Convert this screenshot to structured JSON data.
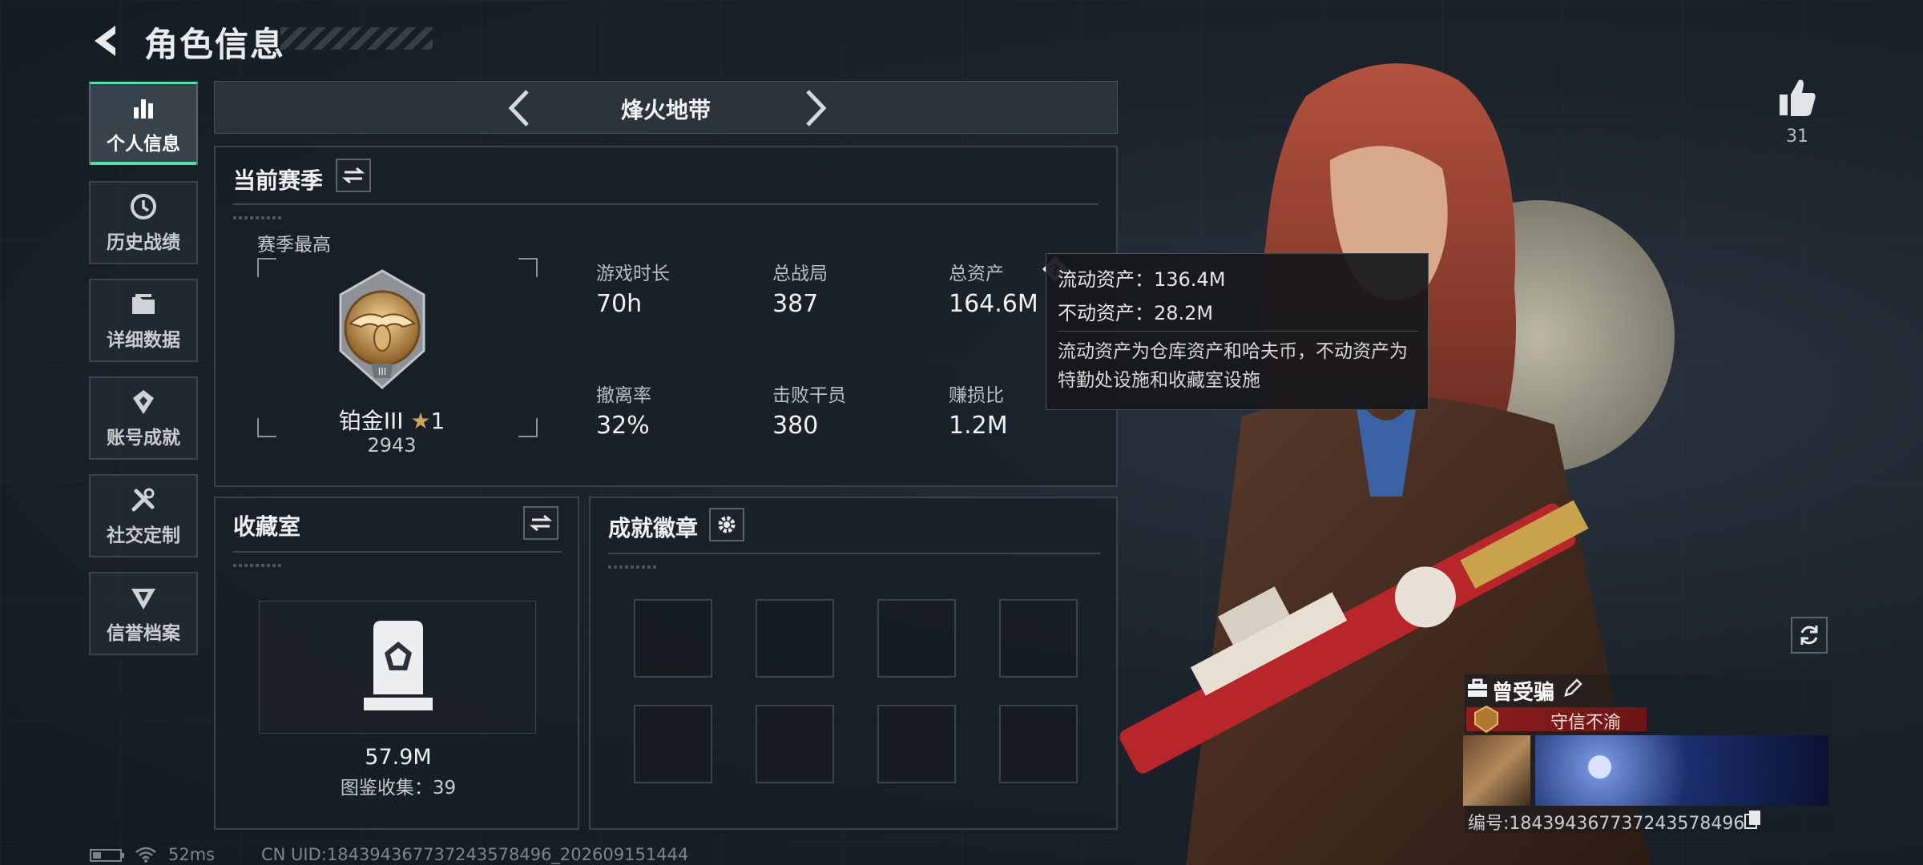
{
  "header": {
    "title": "角色信息"
  },
  "sidebar": {
    "items": [
      {
        "label": "个人信息",
        "icon": "bar-chart-icon",
        "active": true
      },
      {
        "label": "历史战绩",
        "icon": "history-icon",
        "active": false
      },
      {
        "label": "详细数据",
        "icon": "folder-icon",
        "active": false
      },
      {
        "label": "账号成就",
        "icon": "achievement-icon",
        "active": false
      },
      {
        "label": "社交定制",
        "icon": "tools-icon",
        "active": false
      },
      {
        "label": "信誉档案",
        "icon": "shield-icon",
        "active": false
      }
    ]
  },
  "mode": {
    "name": "烽火地带"
  },
  "season": {
    "title": "当前赛季",
    "best_label": "赛季最高",
    "rank_name": "铂金III",
    "rank_stars": "1",
    "rank_score": "2943",
    "stats": [
      {
        "label": "游戏时长",
        "value": "70h"
      },
      {
        "label": "总战局",
        "value": "387"
      },
      {
        "label": "总资产",
        "value": "164.6M"
      },
      {
        "label": "撤离率",
        "value": "32%"
      },
      {
        "label": "击败干员",
        "value": "380"
      },
      {
        "label": "赚损比",
        "value": "1.2M"
      }
    ]
  },
  "tooltip": {
    "liquid": "流动资产：136.4M",
    "fixed": "不动资产：28.2M",
    "desc": "流动资产为仓库资产和哈夫币，不动资产为特勤处设施和收藏室设施"
  },
  "collection": {
    "title": "收藏室",
    "value": "57.9M",
    "count_text": "图鉴收集：39"
  },
  "badges": {
    "title": "成就徽章",
    "slots": 8
  },
  "profile": {
    "likes": "31",
    "name": "曾受骗",
    "honor": "守信不渝",
    "id_text": "编号:184394367737243578496"
  },
  "status": {
    "ping": "52ms",
    "uid": "CN UID:184394367737243578496_202609151444"
  },
  "colors": {
    "accent": "#4fe0a3",
    "honor_red": "#8e1d1d"
  }
}
